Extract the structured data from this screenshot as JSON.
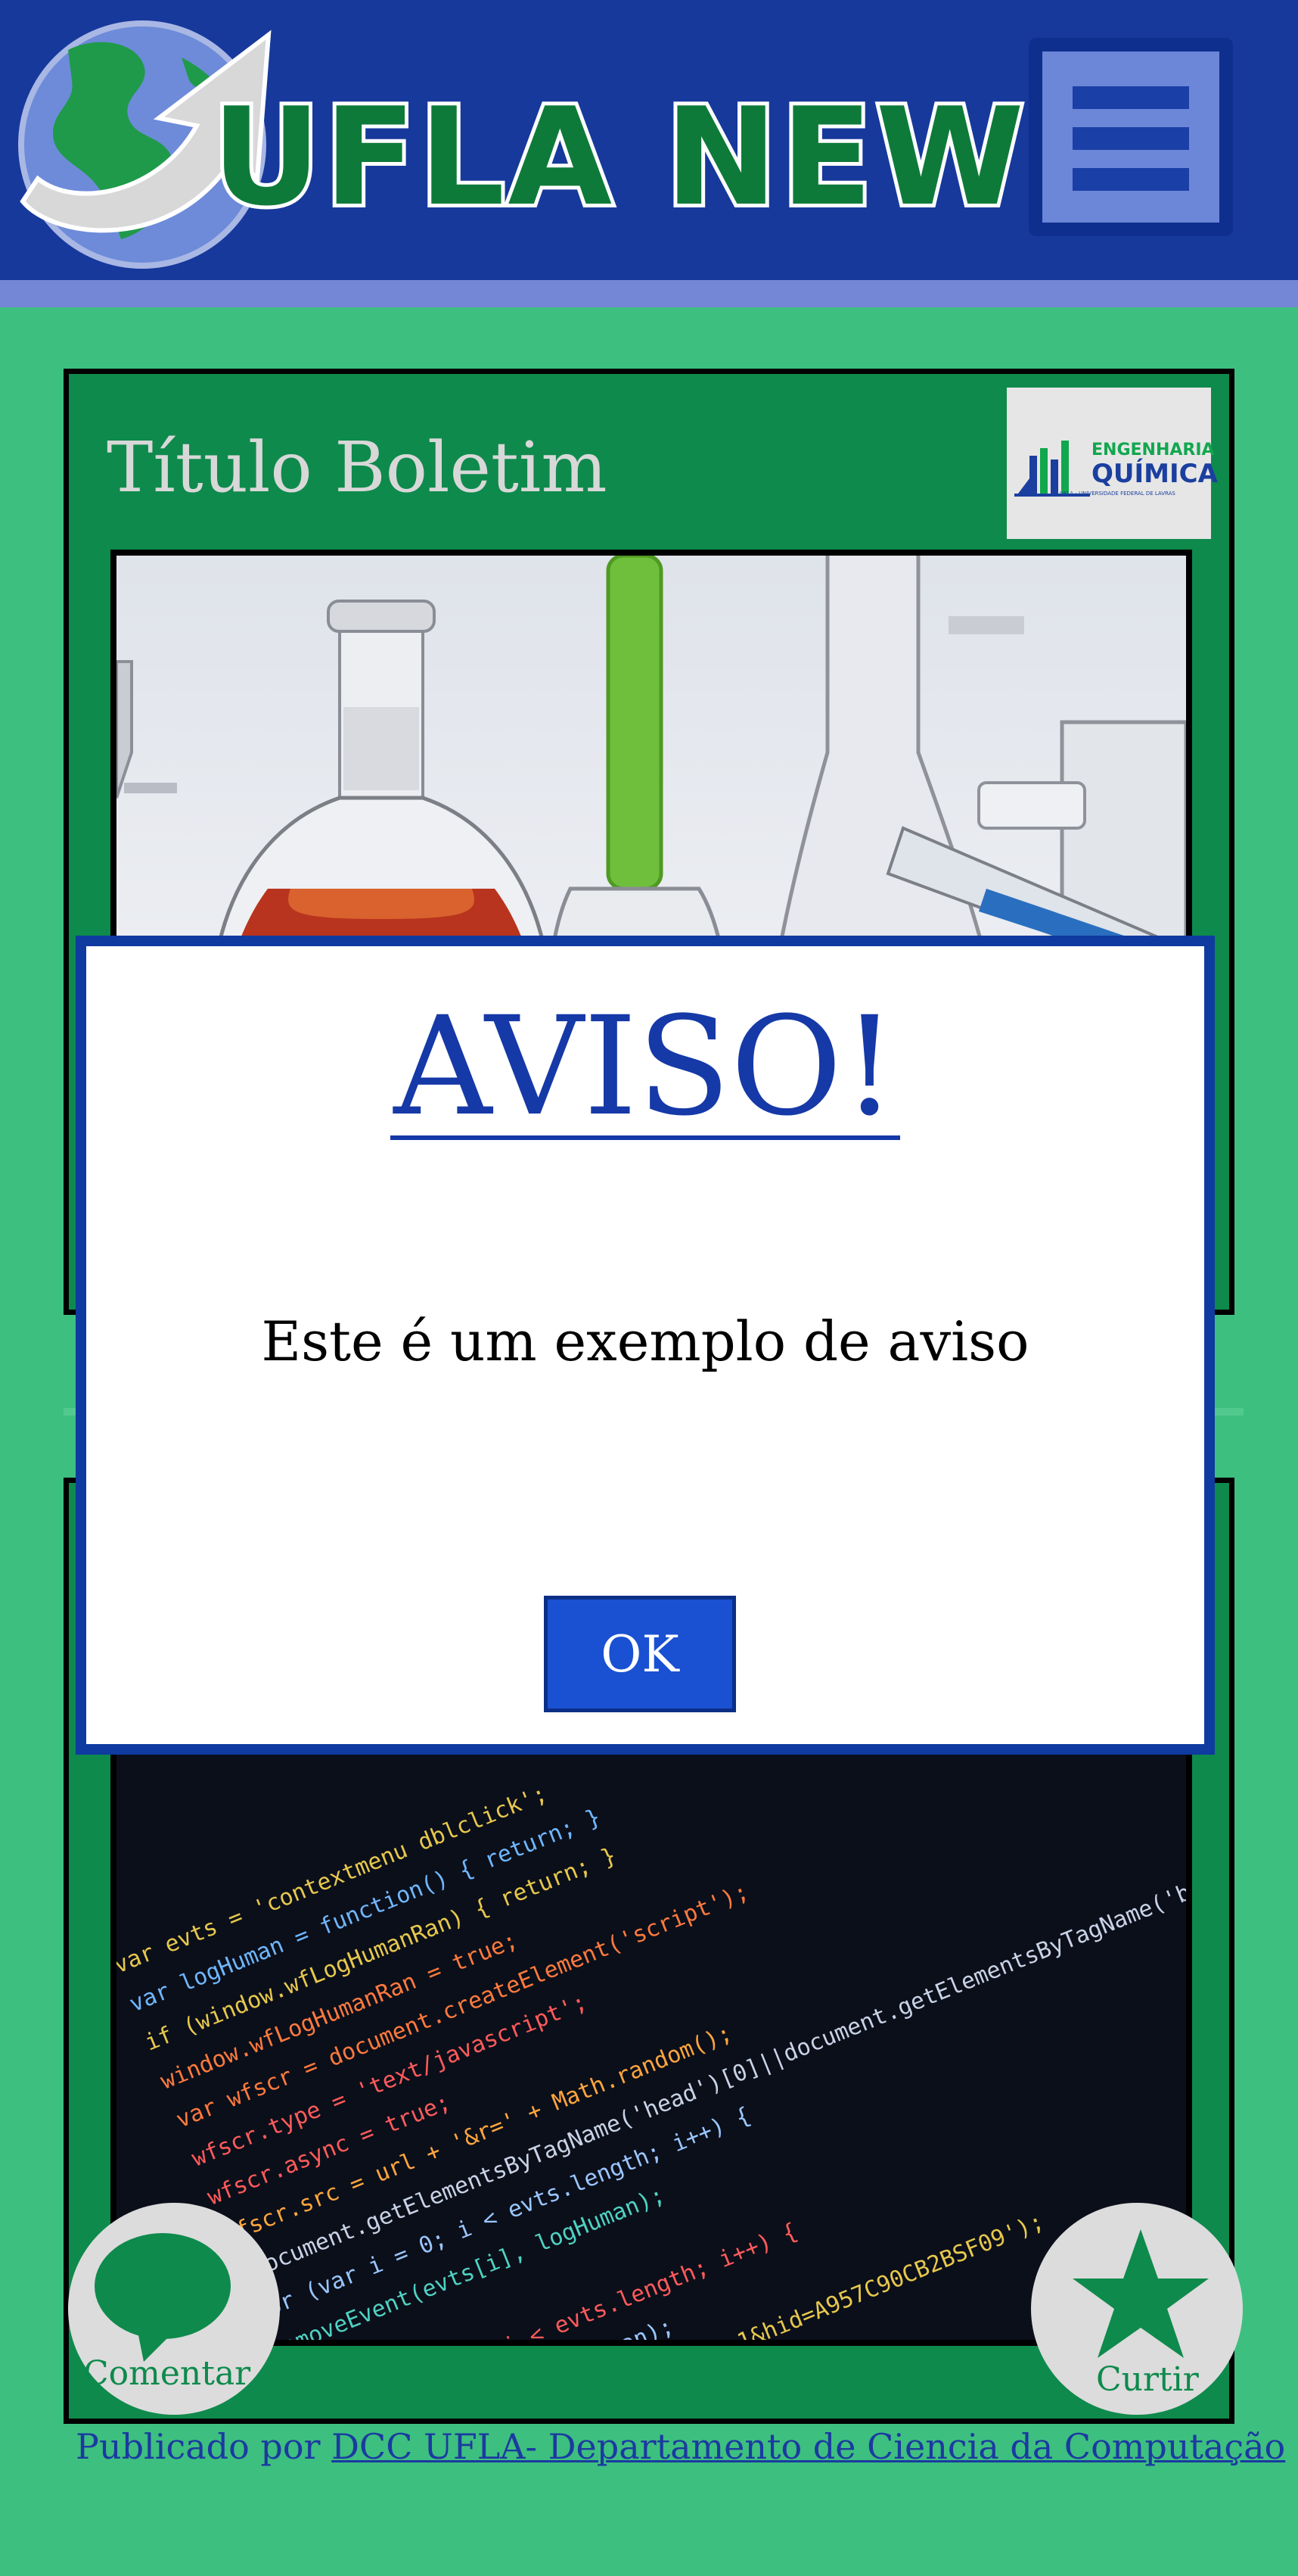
{
  "header": {
    "brand": "UFLA NEWS",
    "menu_icon": "hamburger-menu-icon",
    "logo_icon": "globe-arrow-logo"
  },
  "bulletin": {
    "title": "Título Boletim",
    "course_logo": {
      "line1": "ENGENHARIA",
      "line2": "QUÍMICA",
      "line3": "UFLA - UNIVERSIDADE FEDERAL DE LAVRAS"
    },
    "image_icon": "lab-glassware-image"
  },
  "second_card": {
    "image_icon": "source-code-image"
  },
  "actions": {
    "comment_label": "Comentar",
    "comment_icon": "speech-bubble-icon",
    "like_label": "Curtir",
    "like_icon": "star-icon"
  },
  "footer": {
    "published_by": "Publicado por",
    "publisher": "DCC UFLA- Departamento de Ciencia da Computação"
  },
  "modal": {
    "title": "AVISO!",
    "message": "Este é um exemplo de aviso",
    "ok_label": "OK"
  },
  "colors": {
    "background": "#3dbf80",
    "header": "#17399c",
    "card": "#0e8a4c",
    "modal_border": "#0f3aa0",
    "ok_button": "#1a50d2"
  }
}
